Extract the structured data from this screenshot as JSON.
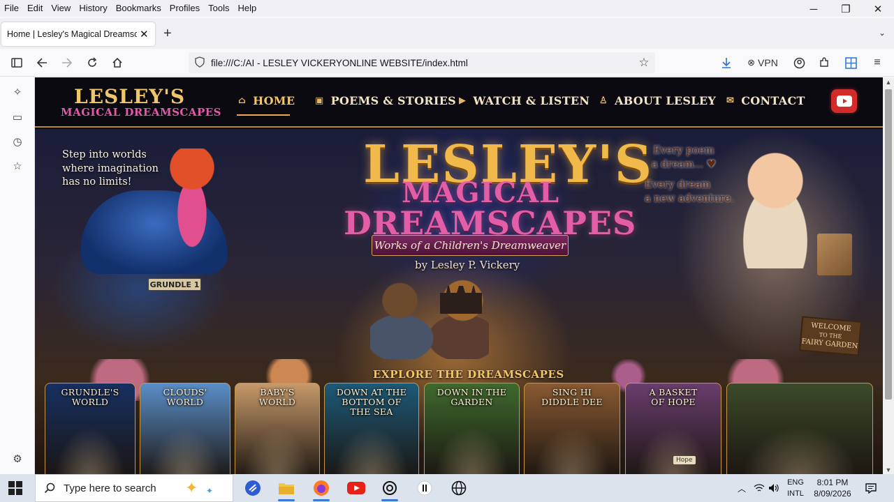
{
  "menubar": {
    "items": [
      "File",
      "Edit",
      "View",
      "History",
      "Bookmarks",
      "Profiles",
      "Tools",
      "Help"
    ]
  },
  "window_controls": {
    "minimize": "─",
    "restore": "❐",
    "close": "✕"
  },
  "tabs": [
    {
      "title": "Home | Lesley's Magical Dreamscapes",
      "close": "✕"
    }
  ],
  "tabstrip": {
    "new_tab": "+",
    "list_tabs": "⌄"
  },
  "toolbar": {
    "url": "file:///C:/AI - LESLEY VICKERYONLINE WEBSITE/index.html",
    "vpn_label": "VPN"
  },
  "site": {
    "logo_line1": "LESLEY'S",
    "logo_line2": "MAGICAL DREAMSCAPES",
    "nav": [
      {
        "label": "HOME",
        "icon": "⌂",
        "active": true
      },
      {
        "label": "POEMS & STORIES",
        "icon": "▣"
      },
      {
        "label": "WATCH & LISTEN",
        "icon": "▶"
      },
      {
        "label": "ABOUT LESLEY",
        "icon": "♙"
      },
      {
        "label": "CONTACT",
        "icon": "✉"
      }
    ],
    "youtube_icon": "youtube-icon"
  },
  "hero": {
    "tagline_left": [
      "Step into worlds",
      "where imagination",
      "has no limits!"
    ],
    "tagline_right1": [
      "Every poem",
      "a dream... ♥"
    ],
    "tagline_right2": [
      "Every dream",
      "a new adventure."
    ],
    "title_line1": "LESLEY'S",
    "title_line2": "MAGICAL",
    "title_line3": "DREAMSCAPES",
    "ribbon": "Works of a Children's Dreamweaver",
    "byline": "by Lesley P. Vickery",
    "plate": "GRUNDLE 1",
    "sign": [
      "WELCOME",
      "TO THE",
      "FAIRY GARDEN"
    ],
    "explore_heading": "EXPLORE THE DREAMSCAPES"
  },
  "cards": [
    {
      "title": [
        "GRUNDLE'S",
        "WORLD"
      ],
      "color": "#173061"
    },
    {
      "title": [
        "CLOUDS'",
        "WORLD"
      ],
      "color": "#5a8ec8"
    },
    {
      "title": [
        "BABY'S",
        "WORLD"
      ],
      "color": "#c79a6a"
    },
    {
      "title": [
        "DOWN AT THE",
        "BOTTOM OF",
        "THE SEA"
      ],
      "color": "#1d5a78"
    },
    {
      "title": [
        "DOWN IN THE",
        "GARDEN"
      ],
      "color": "#3f6a2e"
    },
    {
      "title": [
        "SING HI",
        "DIDDLE DEE"
      ],
      "color": "#8a5a32"
    },
    {
      "title": [
        "A BASKET",
        "OF HOPE"
      ],
      "color": "#6a3e6e",
      "tag": "Hope"
    },
    {
      "title": [],
      "color": "#3c4a2a"
    }
  ],
  "taskbar": {
    "search_placeholder": "Type here to search",
    "language": [
      "ENG",
      "INTL"
    ],
    "time": "8:01 PM",
    "date": "8/09/2026"
  }
}
